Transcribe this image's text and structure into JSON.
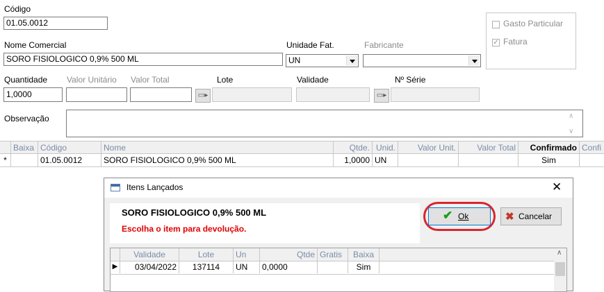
{
  "form": {
    "codigo_label": "Código",
    "codigo_value": "01.05.0012",
    "nome_label": "Nome Comercial",
    "nome_value": "SORO FISIOLOGICO 0,9% 500 ML",
    "unidade_label": "Unidade Fat.",
    "unidade_value": "UN",
    "fabricante_label": "Fabricante",
    "fabricante_value": "",
    "gasto_label": "Gasto Particular",
    "gasto_checked": false,
    "fatura_label": "Fatura",
    "fatura_checked": true,
    "quantidade_label": "Quantidade",
    "quantidade_value": "1,0000",
    "valor_unitario_label": "Valor Unitário",
    "valor_total_label": "Valor Total",
    "lote_label": "Lote",
    "validade_label": "Validade",
    "serie_label": "Nº Série",
    "observacao_label": "Observação"
  },
  "grid": {
    "columns": [
      "Baixa",
      "Código",
      "Nome",
      "Qtde.",
      "Unid.",
      "Valor Unit.",
      "Valor Total",
      "Confirmado",
      "Confi"
    ],
    "rows": [
      {
        "marker": "*",
        "baixa": "",
        "codigo": "01.05.0012",
        "nome": "SORO FISIOLOGICO 0,9% 500 ML",
        "qtde": "1,0000",
        "unid": "UN",
        "valor_unit": "",
        "valor_total": "",
        "confirmado": "Sim"
      }
    ]
  },
  "dialog": {
    "title": "Itens Lançados",
    "product": "SORO FISIOLOGICO 0,9% 500 ML",
    "message": "Escolha o item para devolução.",
    "ok_label": "Ok",
    "cancel_label": "Cancelar",
    "columns": [
      "Validade",
      "Lote",
      "Un",
      "Qtde",
      "Gratis",
      "Baixa"
    ],
    "rows": [
      {
        "marker": "▶",
        "validade": "03/04/2022",
        "lote": "137114",
        "un": "UN",
        "qtde": "0,0000",
        "gratis": "",
        "baixa": "Sim"
      }
    ],
    "colors": {
      "message": "#e00000",
      "highlight_ring": "#d9262c",
      "ok_check": "#1a9e1a",
      "cancel_x": "#c0392b"
    }
  }
}
